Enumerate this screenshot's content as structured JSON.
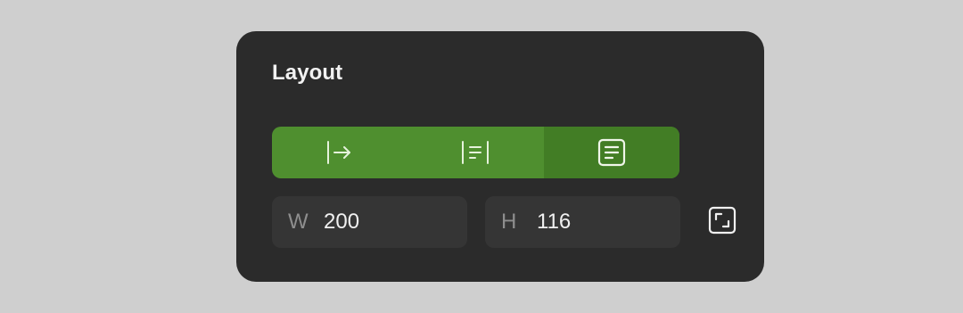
{
  "panel": {
    "title": "Layout"
  },
  "layout_modes": [
    {
      "icon": "arrow-right-from-bar-icon",
      "active": false
    },
    {
      "icon": "align-text-between-bars-icon",
      "active": false
    },
    {
      "icon": "text-box-icon",
      "active": true
    }
  ],
  "size": {
    "width_label": "W",
    "width_value": "200",
    "height_label": "H",
    "height_value": "116"
  },
  "resize_icon": "resize-corners-icon",
  "colors": {
    "background": "#cfcfcf",
    "panel": "#2b2b2b",
    "accent": "#4f8f2f",
    "accent_active": "#427d25",
    "field": "#353535"
  }
}
